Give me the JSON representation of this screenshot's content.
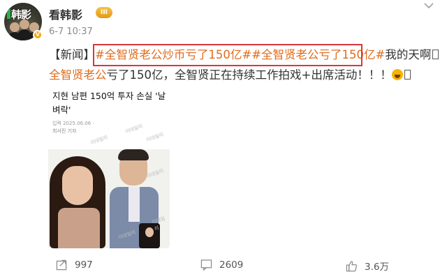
{
  "header": {
    "avatar_text": "韩影",
    "username": "看韩影",
    "vip_badge": "III",
    "time": "6-7 10:37"
  },
  "post": {
    "prefix": "【新闻】",
    "hashtag1": "#全智贤老公炒币亏了150亿#",
    "hashtag2": "#全智贤老公亏了150亿#",
    "after_tags": "我的天啊",
    "line2_name": "全智贤老公",
    "line2_rest": "亏了150亿，全智贤正在持续工作拍戏+出席活动！！！",
    "highlight_color": "#e06b1c",
    "box_color": "#d9363e"
  },
  "card": {
    "title": "지현 남편 150억 투자 손실 '날벼락'",
    "meta": "입력 2025.06.06 ·",
    "reporter": "최서진 기자",
    "watermarks": [
      "이데일리",
      "이데일리",
      "이데일리",
      "이데일리",
      "이데일리",
      "이데일리"
    ]
  },
  "footer": {
    "share_count": "997",
    "comment_count": "2609",
    "like_count": "3.6万"
  },
  "icons": {
    "more": "chevron-down-icon",
    "share": "share-icon",
    "comment": "comment-icon",
    "like": "thumbs-up-icon"
  }
}
